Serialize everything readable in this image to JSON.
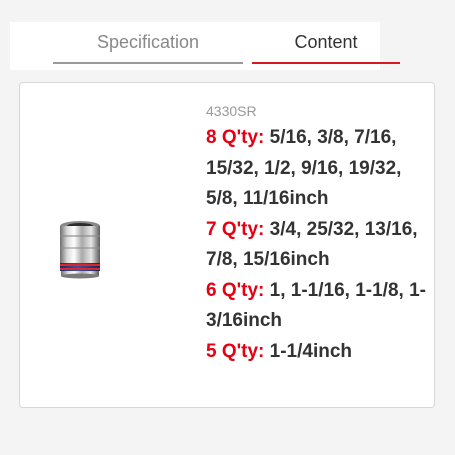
{
  "tabs": [
    {
      "label": "Specification",
      "active": false
    },
    {
      "label": "Content",
      "active": true
    }
  ],
  "product": {
    "model": "4330SR",
    "image_icon": "chrome-socket-icon",
    "groups": [
      {
        "qty": "8 Q'ty:",
        "sizes": "5/16, 3/8, 7/16, 15/32, 1/2, 9/16, 19/32, 5/8, 11/16inch"
      },
      {
        "qty": "7 Q'ty:",
        "sizes": "3/4, 25/32, 13/16, 7/8, 15/16inch"
      },
      {
        "qty": "6 Q'ty:",
        "sizes": "1, 1-1/16, 1-1/8, 1-3/16inch"
      },
      {
        "qty": "5 Q'ty:",
        "sizes": "1-1/4inch"
      }
    ]
  },
  "colors": {
    "accent": "#d71920",
    "qty_red": "#e60012",
    "text_dark": "#333333",
    "text_muted": "#999999"
  }
}
